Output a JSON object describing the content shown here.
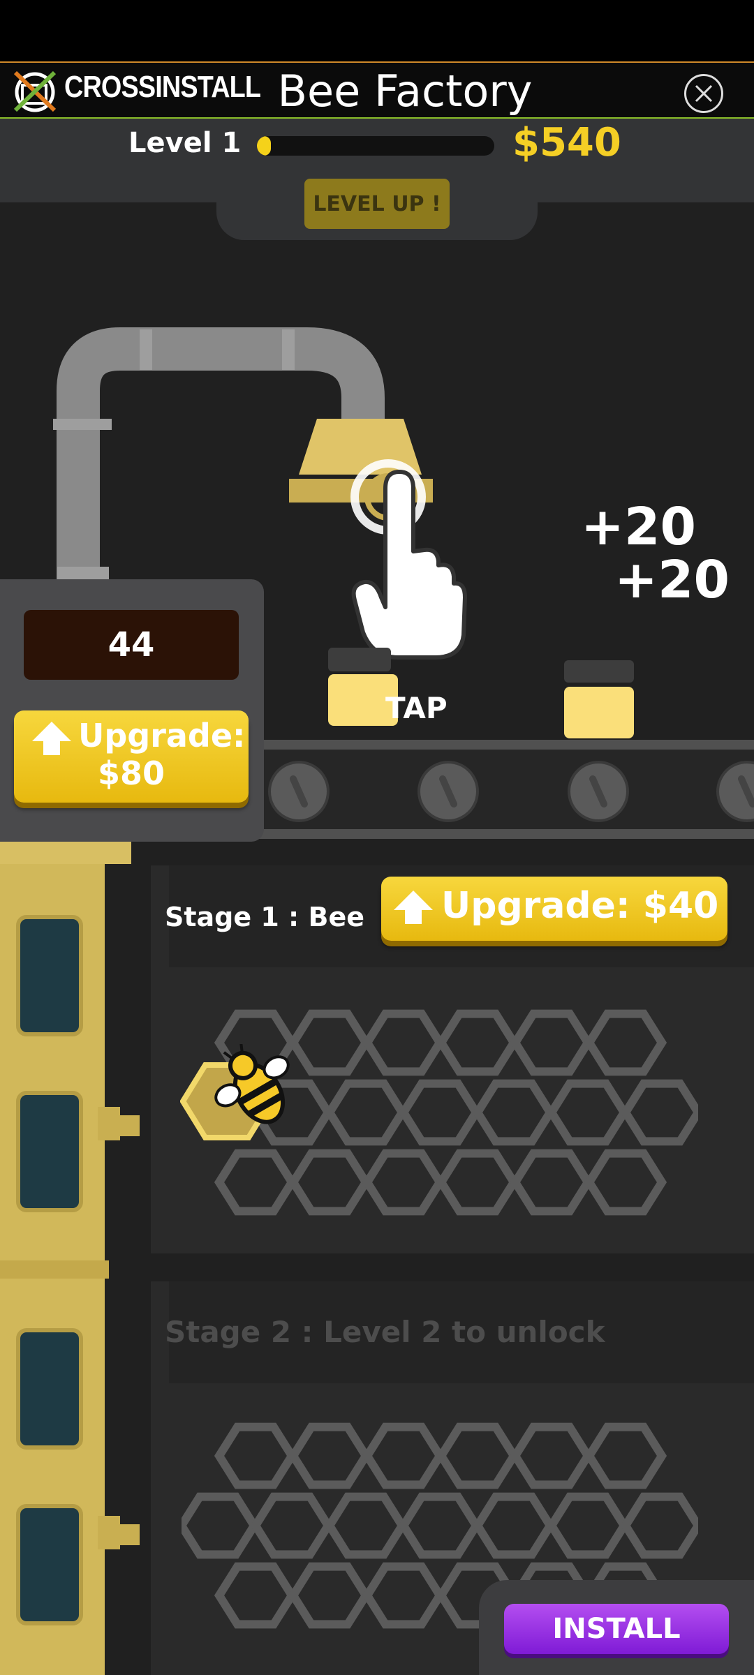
{
  "ad": {
    "brand": "CROSSINSTALL",
    "title": "Bee Factory"
  },
  "hud": {
    "level_label": "Level 1",
    "level_progress_fraction": 0.06,
    "money": "$540",
    "level_up_label": "LEVEL UP !"
  },
  "machine": {
    "counter": "44",
    "upgrade_label": "Upgrade:",
    "upgrade_price": "$80"
  },
  "hint": {
    "tap_label": "TAP",
    "popups": [
      "+20",
      "+20"
    ]
  },
  "stages": [
    {
      "title": "Stage 1 : Bee",
      "upgrade_label": "Upgrade: $40"
    },
    {
      "title": "Stage 2 : Level 2 to unlock"
    }
  ],
  "install_label": "INSTALL",
  "colors": {
    "gold": "#f5cf25",
    "button_yellow": "#efc61f",
    "install_purple": "#9a2ee6",
    "background": "#202020"
  },
  "icons": [
    "crossinstall-logo-icon",
    "close-icon",
    "tap-hand-icon",
    "upgrade-arrow-icon",
    "bee-icon",
    "honeycomb-grid"
  ]
}
